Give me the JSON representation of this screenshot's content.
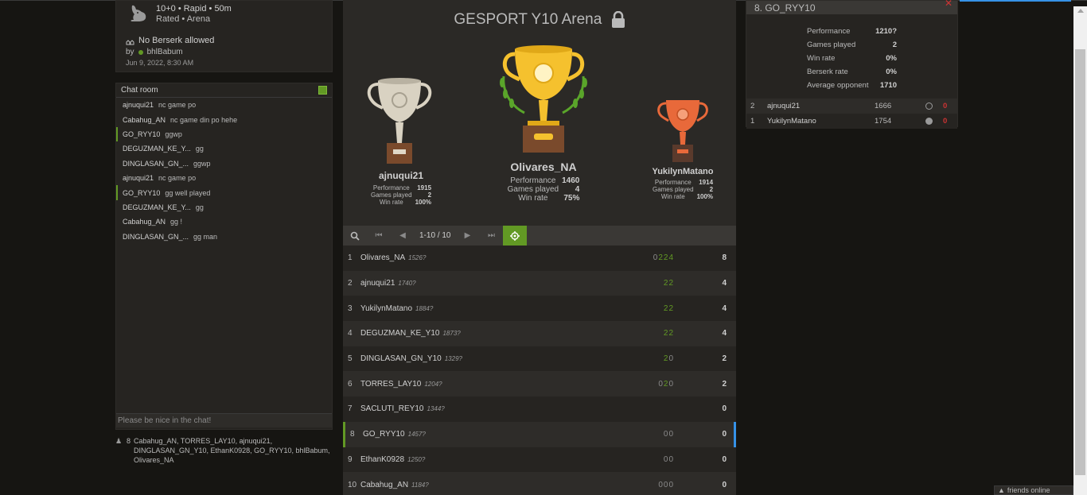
{
  "tournament": {
    "clock_line": "10+0 • Rapid • 50m",
    "rated_line": "Rated • Arena",
    "berserk": "No Berserk allowed",
    "by_label": "by",
    "creator": "bhlBabum",
    "date": "Jun 9, 2022, 8:30 AM",
    "title": "GESPORT Y10 Arena"
  },
  "chat": {
    "title": "Chat room",
    "placeholder": "Please be nice in the chat!",
    "messages": [
      {
        "user": "ajnuqui21",
        "text": "nc game po",
        "hl": false
      },
      {
        "user": "Cabahug_AN",
        "text": "nc game din po hehe",
        "hl": false
      },
      {
        "user": "GO_RYY10",
        "text": "ggwp",
        "hl": true
      },
      {
        "user": "DEGUZMAN_KE_Y...",
        "text": "gg",
        "hl": false
      },
      {
        "user": "DINGLASAN_GN_...",
        "text": "ggwp",
        "hl": false
      },
      {
        "user": "ajnuqui21",
        "text": "nc game po",
        "hl": false
      },
      {
        "user": "GO_RYY10",
        "text": "gg well played",
        "hl": true
      },
      {
        "user": "DEGUZMAN_KE_Y...",
        "text": "gg",
        "hl": false
      },
      {
        "user": "Cabahug_AN",
        "text": "gg !",
        "hl": false
      },
      {
        "user": "DINGLASAN_GN_...",
        "text": "gg man",
        "hl": false
      }
    ]
  },
  "spectators": {
    "count": "8",
    "names": "Cabahug_AN, TORRES_LAY10, ajnuqui21, DINGLASAN_GN_Y10, EthanK0928, GO_RYY10, bhlBabum, Olivares_NA"
  },
  "podium": {
    "first": {
      "name": "Olivares_NA",
      "performance": "1460",
      "games": "4",
      "winrate": "75%"
    },
    "second": {
      "name": "ajnuqui21",
      "performance": "1915",
      "games": "2",
      "winrate": "100%"
    },
    "third": {
      "name": "YukilynMatano",
      "performance": "1914",
      "games": "2",
      "winrate": "100%"
    },
    "labels": {
      "performance": "Performance",
      "games": "Games played",
      "winrate": "Win rate"
    }
  },
  "pager": {
    "pages": "1-10 / 10"
  },
  "standings": [
    {
      "rank": "1",
      "name": "Olivares_NA",
      "rating": "1526?",
      "sheet": [
        [
          "0",
          "z"
        ],
        [
          "2",
          "w"
        ],
        [
          "2",
          "w"
        ],
        [
          "4",
          "w"
        ]
      ],
      "score": "8",
      "me": false
    },
    {
      "rank": "2",
      "name": "ajnuqui21",
      "rating": "1740?",
      "sheet": [
        [
          "2",
          "w"
        ],
        [
          "2",
          "w"
        ]
      ],
      "score": "4",
      "me": false
    },
    {
      "rank": "3",
      "name": "YukilynMatano",
      "rating": "1884?",
      "sheet": [
        [
          "2",
          "w"
        ],
        [
          "2",
          "w"
        ]
      ],
      "score": "4",
      "me": false
    },
    {
      "rank": "4",
      "name": "DEGUZMAN_KE_Y10",
      "rating": "1873?",
      "sheet": [
        [
          "2",
          "w"
        ],
        [
          "2",
          "w"
        ]
      ],
      "score": "4",
      "me": false
    },
    {
      "rank": "5",
      "name": "DINGLASAN_GN_Y10",
      "rating": "1329?",
      "sheet": [
        [
          "2",
          "w"
        ],
        [
          "0",
          "z"
        ]
      ],
      "score": "2",
      "me": false
    },
    {
      "rank": "6",
      "name": "TORRES_LAY10",
      "rating": "1204?",
      "sheet": [
        [
          "0",
          "z"
        ],
        [
          "2",
          "w"
        ],
        [
          "0",
          "z"
        ]
      ],
      "score": "2",
      "me": false
    },
    {
      "rank": "7",
      "name": "SACLUTI_REY10",
      "rating": "1344?",
      "sheet": [],
      "score": "0",
      "me": false
    },
    {
      "rank": "8",
      "name": "GO_RYY10",
      "rating": "1457?",
      "sheet": [
        [
          "0",
          "z"
        ],
        [
          "0",
          "z"
        ]
      ],
      "score": "0",
      "me": true
    },
    {
      "rank": "9",
      "name": "EthanK0928",
      "rating": "1250?",
      "sheet": [
        [
          "0",
          "z"
        ],
        [
          "0",
          "z"
        ]
      ],
      "score": "0",
      "me": false
    },
    {
      "rank": "10",
      "name": "Cabahug_AN",
      "rating": "1184?",
      "sheet": [
        [
          "0",
          "z"
        ],
        [
          "0",
          "z"
        ],
        [
          "0",
          "z"
        ]
      ],
      "score": "0",
      "me": false
    }
  ],
  "player": {
    "header": "8. GO_RYY10",
    "stats": [
      {
        "k": "Performance",
        "v": "1210?"
      },
      {
        "k": "Games played",
        "v": "2"
      },
      {
        "k": "Win rate",
        "v": "0%"
      },
      {
        "k": "Berserk rate",
        "v": "0%"
      },
      {
        "k": "Average opponent",
        "v": "1710"
      }
    ],
    "games": [
      {
        "idx": "2",
        "opponent": "ajnuqui21",
        "rating": "1666",
        "color": "white",
        "result": "0"
      },
      {
        "idx": "1",
        "opponent": "YukilynMatano",
        "rating": "1754",
        "color": "black",
        "result": "0"
      }
    ]
  },
  "friends": {
    "label": "friends online"
  },
  "colors": {
    "accent_green": "#629924",
    "accent_blue": "#3692e7",
    "loss_red": "#cc3333"
  }
}
